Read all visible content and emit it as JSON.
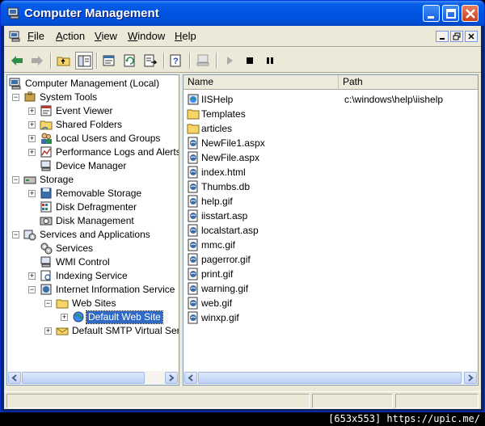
{
  "window": {
    "title": "Computer Management"
  },
  "menubar": {
    "items": [
      {
        "label": "File",
        "accel": "F",
        "rest": "ile"
      },
      {
        "label": "Action",
        "accel": "A",
        "rest": "ction"
      },
      {
        "label": "View",
        "accel": "V",
        "rest": "iew"
      },
      {
        "label": "Window",
        "accel": "W",
        "rest": "indow"
      },
      {
        "label": "Help",
        "accel": "H",
        "rest": "elp"
      }
    ]
  },
  "toolbar": {
    "icons": [
      "back-arrow-icon",
      "forward-arrow-icon",
      "up-folder-icon",
      "show-hide-tree-icon",
      "properties-icon",
      "refresh-icon",
      "export-list-icon",
      "help-icon",
      "computer-icon",
      "play-icon",
      "stop-icon",
      "pause-icon"
    ]
  },
  "tree": {
    "root": "Computer Management (Local)",
    "system_tools": "System Tools",
    "event_viewer": "Event Viewer",
    "shared_folders": "Shared Folders",
    "local_users": "Local Users and Groups",
    "perf_logs": "Performance Logs and Alerts",
    "device_manager": "Device Manager",
    "storage": "Storage",
    "removable_storage": "Removable Storage",
    "disk_defrag": "Disk Defragmenter",
    "disk_mgmt": "Disk Management",
    "services_apps": "Services and Applications",
    "services": "Services",
    "wmi": "WMI Control",
    "indexing": "Indexing Service",
    "iis": "Internet Information Service",
    "web_sites": "Web Sites",
    "default_web_site": "Default Web Site",
    "default_smtp": "Default SMTP Virtual Serv"
  },
  "list": {
    "columns": {
      "name": "Name",
      "path": "Path"
    },
    "rows": [
      {
        "name": "IISHelp",
        "path": "c:\\windows\\help\\iishelp",
        "icon": "vdir-icon"
      },
      {
        "name": "Templates",
        "path": "",
        "icon": "folder-icon"
      },
      {
        "name": "articles",
        "path": "",
        "icon": "folder-icon"
      },
      {
        "name": "NewFile1.aspx",
        "path": "",
        "icon": "web-file-icon"
      },
      {
        "name": "NewFile.aspx",
        "path": "",
        "icon": "web-file-icon"
      },
      {
        "name": "index.html",
        "path": "",
        "icon": "web-file-icon"
      },
      {
        "name": "Thumbs.db",
        "path": "",
        "icon": "web-file-icon"
      },
      {
        "name": "help.gif",
        "path": "",
        "icon": "web-file-icon"
      },
      {
        "name": "iisstart.asp",
        "path": "",
        "icon": "web-file-icon"
      },
      {
        "name": "localstart.asp",
        "path": "",
        "icon": "web-file-icon"
      },
      {
        "name": "mmc.gif",
        "path": "",
        "icon": "web-file-icon"
      },
      {
        "name": "pagerror.gif",
        "path": "",
        "icon": "web-file-icon"
      },
      {
        "name": "print.gif",
        "path": "",
        "icon": "web-file-icon"
      },
      {
        "name": "warning.gif",
        "path": "",
        "icon": "web-file-icon"
      },
      {
        "name": "web.gif",
        "path": "",
        "icon": "web-file-icon"
      },
      {
        "name": "winxp.gif",
        "path": "",
        "icon": "web-file-icon"
      }
    ]
  },
  "watermark": "[653x553] https://upic.me/",
  "colors": {
    "titlebar": "#0054e3",
    "face": "#ece9d8",
    "selection": "#316ac5"
  }
}
